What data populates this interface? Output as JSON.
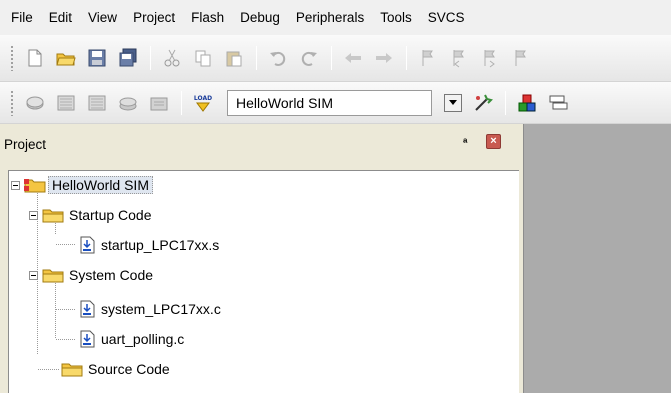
{
  "menu": {
    "items": [
      "File",
      "Edit",
      "View",
      "Project",
      "Flash",
      "Debug",
      "Peripherals",
      "Tools",
      "SVCS"
    ]
  },
  "toolbar": {
    "row1_icons": [
      "new-file-icon",
      "open-folder-icon",
      "save-icon",
      "save-all-icon",
      "cut-icon",
      "copy-icon",
      "paste-icon",
      "undo-icon",
      "redo-icon",
      "nav-back-icon",
      "nav-forward-icon",
      "bookmark-icon",
      "bookmark-prev-icon",
      "bookmark-next-icon",
      "bookmark-clear-icon"
    ],
    "row2_icons": [
      "translate-icon",
      "build-icon",
      "rebuild-icon",
      "batch-build-icon",
      "stop-build-icon",
      "load-icon"
    ],
    "load_label": "LOAD",
    "target": "HelloWorld SIM"
  },
  "project": {
    "title": "Project",
    "pin_glyph": "ª",
    "close_glyph": "×",
    "tree": {
      "root": "HelloWorld SIM",
      "groups": [
        {
          "label": "Startup Code",
          "files": [
            "startup_LPC17xx.s"
          ]
        },
        {
          "label": "System Code",
          "files": [
            "system_LPC17xx.c",
            "uart_polling.c"
          ]
        },
        {
          "label": "Source Code",
          "files": []
        }
      ]
    }
  },
  "colors": {
    "accent_folder": "#f4c542",
    "right_area": "#ababab",
    "panel_bg": "#ece9d8"
  }
}
